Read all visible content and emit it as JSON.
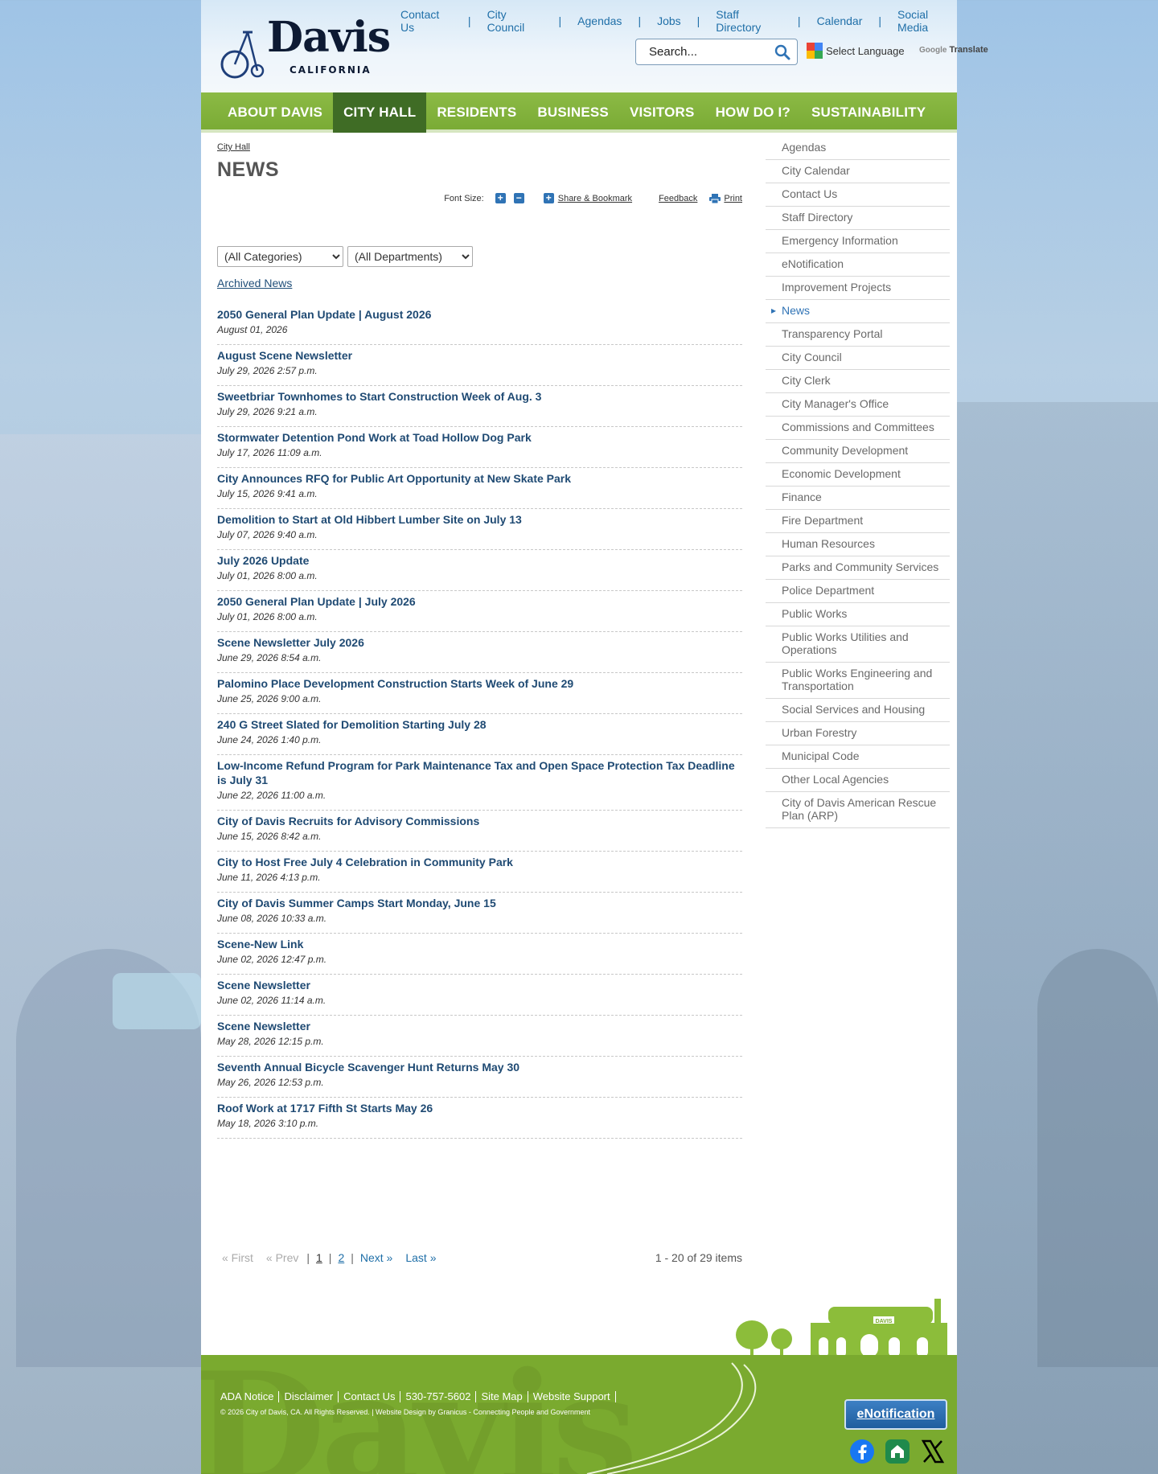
{
  "logo": {
    "name": "Davis",
    "subtitle": "CALIFORNIA"
  },
  "top_links": [
    "Contact Us",
    "City Council",
    "Agendas",
    "Jobs",
    "Staff Directory",
    "Calendar",
    "Social Media"
  ],
  "search": {
    "placeholder": "Search..."
  },
  "language": {
    "label": "Select Language",
    "translate": "Translate",
    "powered": "Google"
  },
  "nav": [
    {
      "label": "ABOUT DAVIS",
      "active": false
    },
    {
      "label": "CITY HALL",
      "active": true
    },
    {
      "label": "RESIDENTS",
      "active": false
    },
    {
      "label": "BUSINESS",
      "active": false
    },
    {
      "label": "VISITORS",
      "active": false
    },
    {
      "label": "HOW DO I?",
      "active": false
    },
    {
      "label": "SUSTAINABILITY",
      "active": false
    }
  ],
  "breadcrumb": "City Hall",
  "page_title": "NEWS",
  "tools": {
    "font_size": "Font Size:",
    "share": "Share & Bookmark",
    "feedback": "Feedback",
    "print": "Print"
  },
  "filters": {
    "category": "(All Categories)",
    "department": "(All Departments)"
  },
  "archived": "Archived News",
  "news": [
    {
      "title": "2050 General Plan Update | August 2026",
      "date": "August 01, 2026"
    },
    {
      "title": "August Scene Newsletter",
      "date": "July 29, 2026 2:57 p.m."
    },
    {
      "title": "Sweetbriar Townhomes to Start Construction Week of Aug. 3",
      "date": "July 29, 2026 9:21 a.m."
    },
    {
      "title": "Stormwater Detention Pond Work at Toad Hollow Dog Park",
      "date": "July 17, 2026 11:09 a.m."
    },
    {
      "title": "City Announces RFQ for Public Art Opportunity at New Skate Park",
      "date": "July 15, 2026 9:41 a.m."
    },
    {
      "title": "Demolition to Start at Old Hibbert Lumber Site on July 13",
      "date": "July 07, 2026 9:40 a.m."
    },
    {
      "title": "July 2026 Update",
      "date": "July 01, 2026 8:00 a.m."
    },
    {
      "title": "2050 General Plan Update | July 2026",
      "date": "July 01, 2026 8:00 a.m."
    },
    {
      "title": "Scene Newsletter July 2026",
      "date": "June 29, 2026 8:54 a.m."
    },
    {
      "title": "Palomino Place Development Construction Starts Week of June 29",
      "date": "June 25, 2026 9:00 a.m."
    },
    {
      "title": "240 G Street Slated for Demolition Starting July 28",
      "date": "June 24, 2026 1:40 p.m."
    },
    {
      "title": "Low-Income Refund Program for Park Maintenance Tax and Open Space Protection Tax Deadline is July 31",
      "date": "June 22, 2026 11:00 a.m."
    },
    {
      "title": "City of Davis Recruits for Advisory Commissions",
      "date": "June 15, 2026 8:42 a.m."
    },
    {
      "title": "City to Host Free July 4 Celebration in Community Park",
      "date": "June 11, 2026 4:13 p.m."
    },
    {
      "title": "City of Davis Summer Camps Start Monday, June 15",
      "date": "June 08, 2026 10:33 a.m."
    },
    {
      "title": "Scene-New Link",
      "date": "June 02, 2026 12:47 p.m."
    },
    {
      "title": "Scene Newsletter",
      "date": "June 02, 2026 11:14 a.m."
    },
    {
      "title": "Scene Newsletter",
      "date": "May 28, 2026 12:15 p.m."
    },
    {
      "title": "Seventh Annual Bicycle Scavenger Hunt Returns May 30",
      "date": "May 26, 2026 12:53 p.m."
    },
    {
      "title": "Roof Work at 1717 Fifth St Starts May 26",
      "date": "May 18, 2026 3:10 p.m."
    }
  ],
  "pager": {
    "first": "« First",
    "prev": "« Prev",
    "pages": [
      "1",
      "2"
    ],
    "next": "Next »",
    "last": "Last »",
    "count": "1 - 20 of 29 items"
  },
  "sidebar": [
    "Agendas",
    "City Calendar",
    "Contact Us",
    "Staff Directory",
    "Emergency Information",
    "eNotification",
    "Improvement Projects",
    "News",
    "Transparency Portal",
    "City Council",
    "City Clerk",
    "City Manager's Office",
    "Commissions and Committees",
    "Community Development",
    "Economic Development",
    "Finance",
    "Fire Department",
    "Human Resources",
    "Parks and Community Services",
    "Police Department",
    "Public Works",
    "Public Works Utilities and Operations",
    "Public Works Engineering and Transportation",
    "Social Services and Housing",
    "Urban Forestry",
    "Municipal Code",
    "Other Local Agencies",
    "City of Davis American Rescue Plan (ARP)"
  ],
  "sidebar_current": "News",
  "footer": {
    "links": [
      "ADA Notice",
      "Disclaimer",
      "Contact Us",
      "530-757-5602",
      "Site Map",
      "Website Support"
    ],
    "copyright": "© 2026 City of Davis, CA. All Rights Reserved. | Website Design by Granicus - Connecting People and Government",
    "watermark": "Davis",
    "depot_sign": "DAVIS",
    "enotification": "eNotification",
    "social": [
      "facebook-icon",
      "nextdoor-icon",
      "x-icon"
    ]
  },
  "colors": {
    "nav_green": "#7aab35",
    "nav_active": "#3f6c25",
    "link_blue": "#1f4a73",
    "footer_green": "#7aaa2f"
  }
}
